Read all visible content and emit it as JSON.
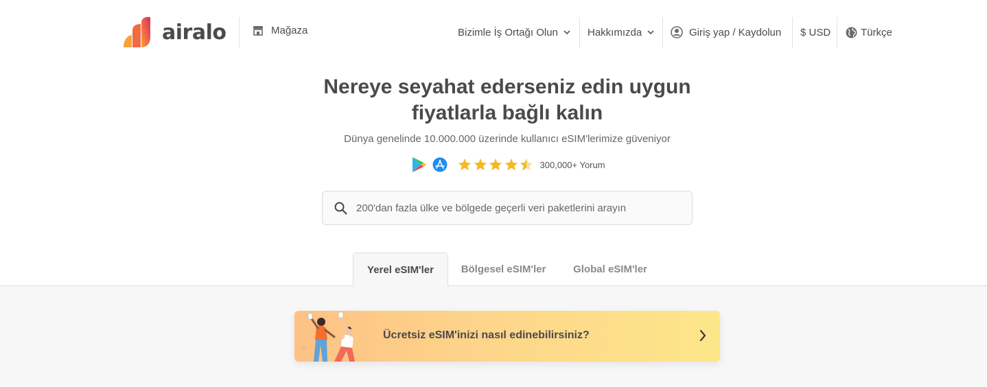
{
  "brand": {
    "name": "airalo"
  },
  "header": {
    "store_label": "Mağaza",
    "partner_label": "Bizimle İş Ortağı Olun",
    "about_label": "Hakkımızda",
    "login_label": "Giriş yap / Kaydolun",
    "currency_label": "$ USD",
    "language_label": "Türkçe"
  },
  "hero": {
    "title_line1": "Nereye seyahat ederseniz edin uygun",
    "title_line2": "fiyatlarla bağlı kalın",
    "subtitle": "Dünya genelinde 10.000.000 üzerinde kullanıcı eSIM'lerimize güveniyor",
    "reviews_label": "300,000+ Yorum",
    "rating": 4.5,
    "rating_max": 5
  },
  "search": {
    "placeholder": "200'dan fazla ülke ve bölgede geçerli veri paketlerini arayın",
    "value": ""
  },
  "tabs": [
    {
      "label": "Yerel eSIM'ler",
      "active": true
    },
    {
      "label": "Bölgesel eSIM'ler",
      "active": false
    },
    {
      "label": "Global eSIM'ler",
      "active": false
    }
  ],
  "banner": {
    "text": "Ücretsiz eSIM'inizi nasıl edinebilirsiniz?"
  },
  "icons": [
    "store-icon",
    "chevron-down-icon",
    "user-icon",
    "globe-icon",
    "google-play-icon",
    "app-store-icon",
    "star-icon",
    "search-icon",
    "chevron-right-icon"
  ],
  "colors": {
    "star": "#f5b921",
    "text": "#4a4a4a",
    "banner_start": "#fdc185",
    "banner_end": "#fde68a"
  }
}
